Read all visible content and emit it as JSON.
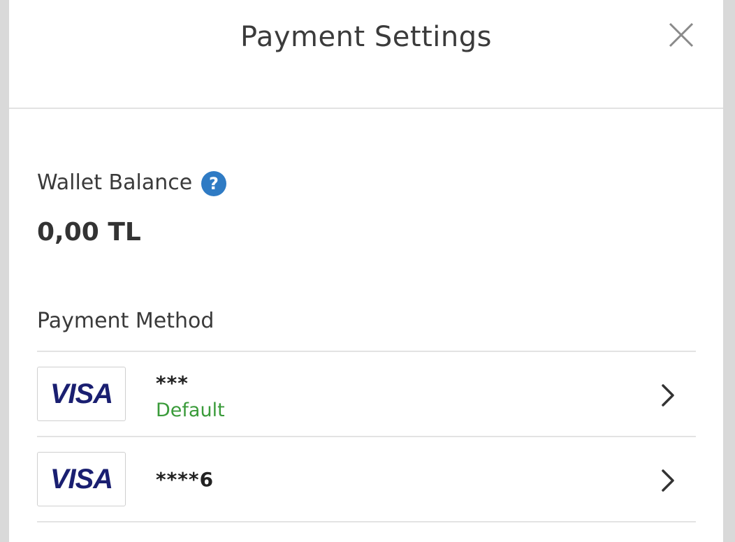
{
  "header": {
    "title": "Payment Settings",
    "close_icon": "close-icon"
  },
  "wallet": {
    "label": "Wallet Balance",
    "help_icon": "help-icon",
    "help_glyph": "?",
    "balance": "0,00 TL"
  },
  "payment_methods": {
    "label": "Payment Method",
    "items": [
      {
        "brand": "VISA",
        "masked_number": "***",
        "status": "Default"
      },
      {
        "brand": "VISA",
        "masked_number": "****6",
        "status": ""
      }
    ]
  },
  "colors": {
    "help_icon": "#2f7bc4",
    "default_status": "#3a9b3a",
    "visa_brand": "#1a1f71"
  }
}
